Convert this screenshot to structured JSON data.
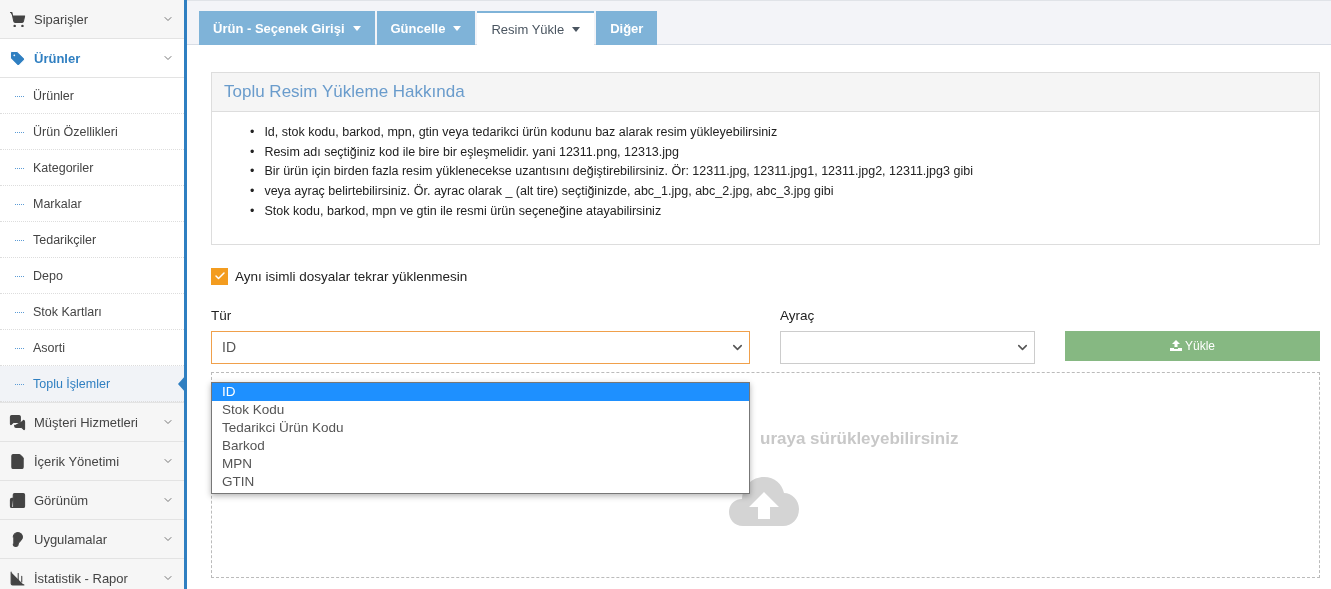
{
  "sidebar": {
    "items": [
      {
        "label": "Siparişler",
        "expanded": false
      },
      {
        "label": "Ürünler",
        "expanded": true,
        "children": [
          {
            "label": "Ürünler",
            "selected": false
          },
          {
            "label": "Ürün Özellikleri",
            "selected": false
          },
          {
            "label": "Kategoriler",
            "selected": false
          },
          {
            "label": "Markalar",
            "selected": false
          },
          {
            "label": "Tedarikçiler",
            "selected": false
          },
          {
            "label": "Depo",
            "selected": false
          },
          {
            "label": "Stok Kartları",
            "selected": false
          },
          {
            "label": "Asorti",
            "selected": false
          },
          {
            "label": "Toplu İşlemler",
            "selected": true
          }
        ]
      },
      {
        "label": "Müşteri Hizmetleri",
        "expanded": false
      },
      {
        "label": "İçerik Yönetimi",
        "expanded": false
      },
      {
        "label": "Görünüm",
        "expanded": false
      },
      {
        "label": "Uygulamalar",
        "expanded": false
      },
      {
        "label": "İstatistik - Rapor",
        "expanded": false
      }
    ]
  },
  "tabs": [
    {
      "label": "Ürün - Seçenek Girişi",
      "has_menu": true,
      "selected": false
    },
    {
      "label": "Güncelle",
      "has_menu": true,
      "selected": false
    },
    {
      "label": "Resim Yükle",
      "has_menu": true,
      "selected": true
    },
    {
      "label": "Diğer",
      "has_menu": false,
      "selected": false
    }
  ],
  "info_panel": {
    "title": "Toplu Resim Yükleme Hakkında",
    "bullet": "•",
    "items": [
      "Id, stok kodu, barkod, mpn, gtin veya tedarikci ürün kodunu baz alarak resim yükleyebilirsiniz",
      "Resim adı seçtiğiniz kod ile bire bir eşleşmelidir. yani 12311.png, 12313.jpg",
      "Bir ürün için birden fazla resim yüklenecekse uzantısını değiştirebilirsiniz. Ör: 12311.jpg, 12311.jpg1, 12311.jpg2, 12311.jpg3 gibi",
      "veya ayraç belirtebilirsiniz. Ör. ayrac olarak _ (alt tire) seçtiğinizde, abc_1.jpg, abc_2.jpg, abc_3.jpg gibi",
      "Stok kodu, barkod, mpn ve gtin ile resmi ürün seçeneğine atayabilirsiniz"
    ]
  },
  "skip_duplicates": {
    "label": "Aynı isimli dosyalar tekrar yüklenmesin",
    "checked": true
  },
  "type_select": {
    "label": "Tür",
    "value": "ID",
    "open": true,
    "options": [
      {
        "label": "ID",
        "selected": true
      },
      {
        "label": "Stok Kodu",
        "selected": false
      },
      {
        "label": "Tedarikci Ürün Kodu",
        "selected": false
      },
      {
        "label": "Barkod",
        "selected": false
      },
      {
        "label": "MPN",
        "selected": false
      },
      {
        "label": "GTIN",
        "selected": false
      }
    ]
  },
  "separator_select": {
    "label": "Ayraç"
  },
  "upload_button": {
    "label": "Yükle"
  },
  "dropzone": {
    "text": "uraya sürükleyebilirsiniz"
  }
}
